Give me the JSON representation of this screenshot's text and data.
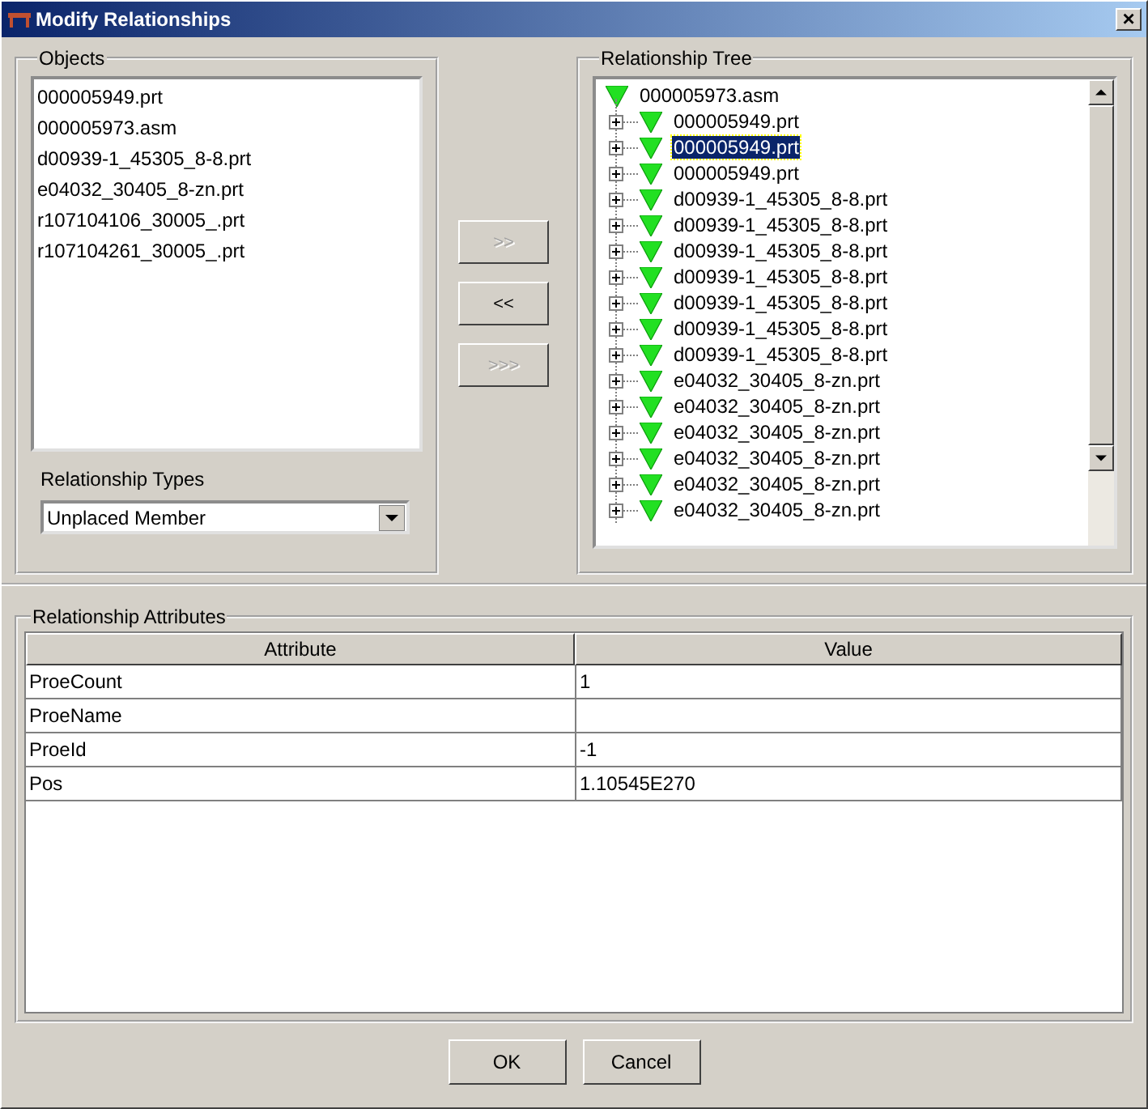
{
  "window": {
    "title": "Modify Relationships",
    "close": "×"
  },
  "objects": {
    "label": "Objects",
    "items": [
      {
        "name": "000005949.prt",
        "selected": false
      },
      {
        "name": "000005973.asm",
        "selected": false
      },
      {
        "name": "d00939-1_45305_8-8.prt",
        "selected": false
      },
      {
        "name": "e04032_30405_8-zn.prt",
        "selected": false
      },
      {
        "name": "r107104106_30005_.prt",
        "selected": false
      },
      {
        "name": "r107104261_30005_.prt",
        "selected": false
      }
    ]
  },
  "relationship_types": {
    "label": "Relationship Types",
    "value": "Unplaced Member"
  },
  "move_buttons": [
    {
      "label": ">>",
      "disabled": true
    },
    {
      "label": "<<",
      "disabled": false
    },
    {
      "label": ">>>",
      "disabled": true
    }
  ],
  "tree": {
    "label": "Relationship Tree",
    "root": {
      "name": "000005973.asm",
      "children": [
        {
          "name": "000005949.prt",
          "expanded": false,
          "selected": false
        },
        {
          "name": "000005949.prt",
          "expanded": false,
          "selected": true
        },
        {
          "name": "000005949.prt",
          "expanded": false,
          "selected": false
        },
        {
          "name": "d00939-1_45305_8-8.prt",
          "expanded": false,
          "selected": false
        },
        {
          "name": "d00939-1_45305_8-8.prt",
          "expanded": false,
          "selected": false
        },
        {
          "name": "d00939-1_45305_8-8.prt",
          "expanded": false,
          "selected": false
        },
        {
          "name": "d00939-1_45305_8-8.prt",
          "expanded": false,
          "selected": false
        },
        {
          "name": "d00939-1_45305_8-8.prt",
          "expanded": false,
          "selected": false
        },
        {
          "name": "d00939-1_45305_8-8.prt",
          "expanded": false,
          "selected": false
        },
        {
          "name": "d00939-1_45305_8-8.prt",
          "expanded": false,
          "selected": false
        },
        {
          "name": "e04032_30405_8-zn.prt",
          "expanded": false,
          "selected": false
        },
        {
          "name": "e04032_30405_8-zn.prt",
          "expanded": false,
          "selected": false
        },
        {
          "name": "e04032_30405_8-zn.prt",
          "expanded": false,
          "selected": false
        },
        {
          "name": "e04032_30405_8-zn.prt",
          "expanded": false,
          "selected": false
        },
        {
          "name": "e04032_30405_8-zn.prt",
          "expanded": false,
          "selected": false
        },
        {
          "name": "e04032_30405_8-zn.prt",
          "expanded": false,
          "selected": false
        }
      ]
    }
  },
  "attributes": {
    "label": "Relationship Attributes",
    "columns": [
      "Attribute",
      "Value"
    ],
    "rows": [
      [
        "ProeCount",
        "1"
      ],
      [
        "ProeName",
        ""
      ],
      [
        "ProeId",
        "-1"
      ],
      [
        "Pos",
        "1.10545E270"
      ]
    ]
  },
  "buttons": [
    "OK",
    "Cancel"
  ]
}
